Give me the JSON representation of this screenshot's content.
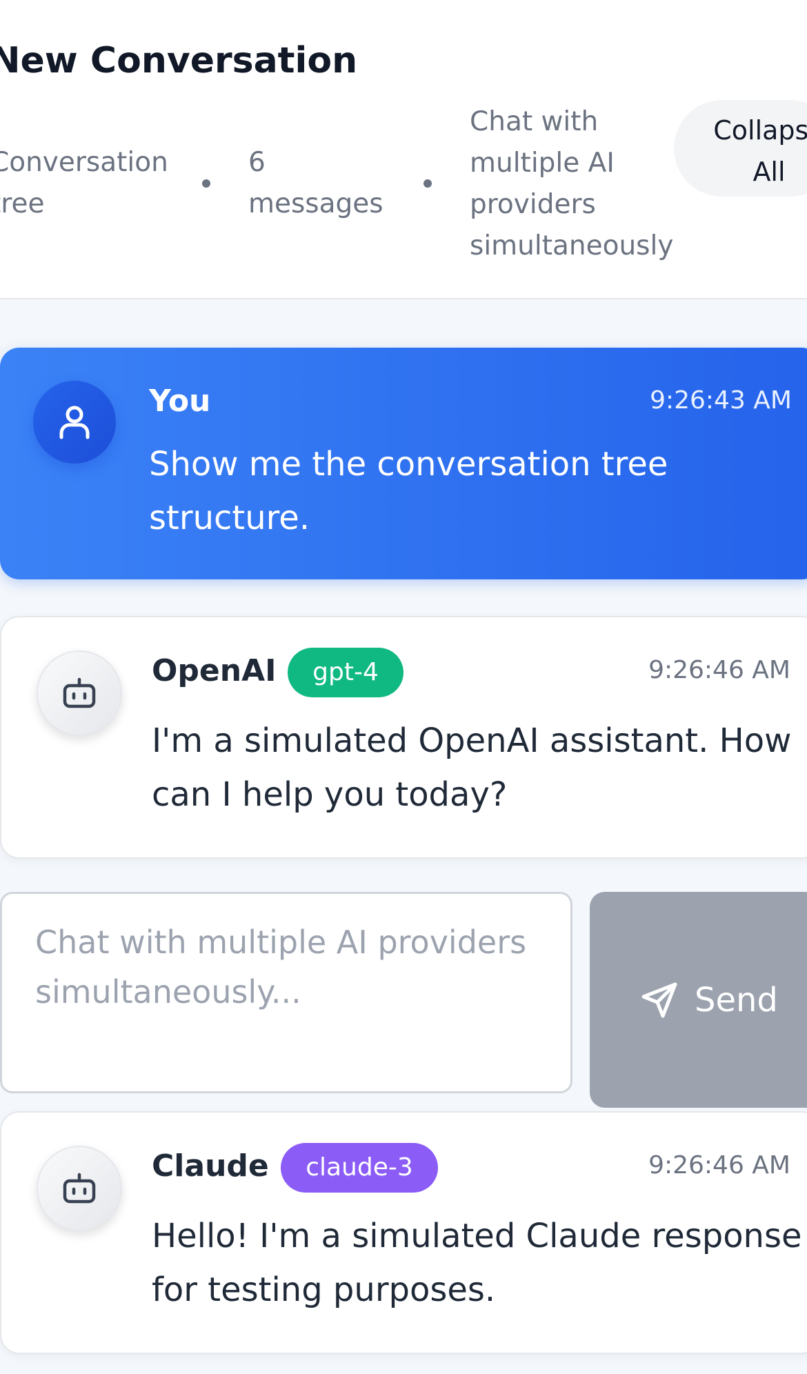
{
  "header": {
    "title": "New Conversation",
    "meta": [
      "Conversation tree",
      "6 messages",
      "Chat with multiple AI providers simultaneously"
    ],
    "collapse_label": "Collapse All"
  },
  "messages": [
    {
      "sender": "You",
      "time": "9:26:43 AM",
      "text": "Show me the conversation tree structure.",
      "avatar_icon": "user-icon"
    },
    {
      "sender": "OpenAI",
      "model": "gpt-4",
      "model_color": "#10b981",
      "time": "9:26:46 AM",
      "text": "I'm a simulated OpenAI assistant. How can I help you today?",
      "avatar_icon": "bot-icon"
    },
    {
      "sender": "Claude",
      "model": "claude-3",
      "model_color": "#8b5cf6",
      "time": "9:26:46 AM",
      "text": "Hello! I'm a simulated Claude response for testing purposes.",
      "avatar_icon": "bot-icon"
    }
  ],
  "composer": {
    "placeholder": "Chat with multiple AI providers simultaneously...",
    "send_label": "Send",
    "send_icon": "send-icon"
  },
  "colors": {
    "user_bubble": "#2563eb",
    "send_disabled": "#9ca3af",
    "page_background": "#f4f7fb"
  }
}
